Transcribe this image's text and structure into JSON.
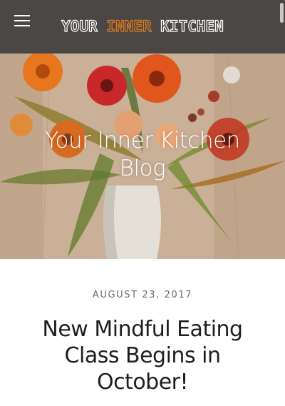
{
  "header": {
    "logo_words": [
      {
        "text": "YOUR ",
        "highlight": false
      },
      {
        "text": "INNER",
        "highlight": true
      },
      {
        "text": " KITCHEN",
        "highlight": false
      }
    ],
    "menu_icon": "hamburger-menu-icon",
    "background_color": "#4a4744",
    "accent_color": "#e07c1f"
  },
  "hero": {
    "image_subject": "flower-bouquet-in-vase",
    "title_lines": [
      "Your Inner Kitchen",
      "Blog"
    ]
  },
  "post": {
    "date": "AUGUST 23, 2017",
    "title_lines": [
      "New Mindful Eating",
      "Class Begins in",
      "October!"
    ]
  }
}
